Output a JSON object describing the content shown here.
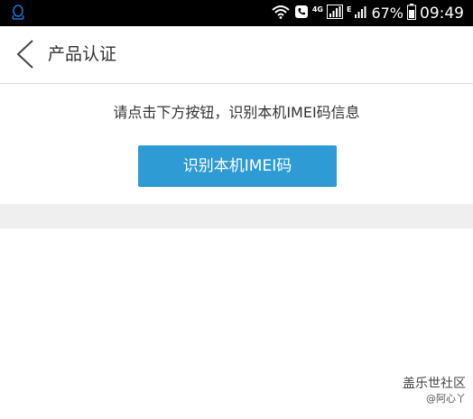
{
  "status_bar": {
    "network_label": "4G",
    "e_label": "E",
    "battery_percent": "67%",
    "time": "09:49",
    "icons": [
      "qq-icon",
      "wifi-icon",
      "call-icon",
      "signal-icon",
      "battery-icon"
    ]
  },
  "header": {
    "title": "产品认证",
    "back_icon": "chevron-left-icon"
  },
  "main": {
    "instruction": "请点击下方按钮，识别本机IMEI码信息",
    "button_label": "识别本机IMEI码"
  },
  "watermark": {
    "line1": "盖乐世社区",
    "line2": "@阿心丫"
  },
  "colors": {
    "button_bg": "#2e9bd4",
    "status_bar_bg": "#000000",
    "qq_icon": "#1a6fd6",
    "divider_band": "#efefef"
  }
}
